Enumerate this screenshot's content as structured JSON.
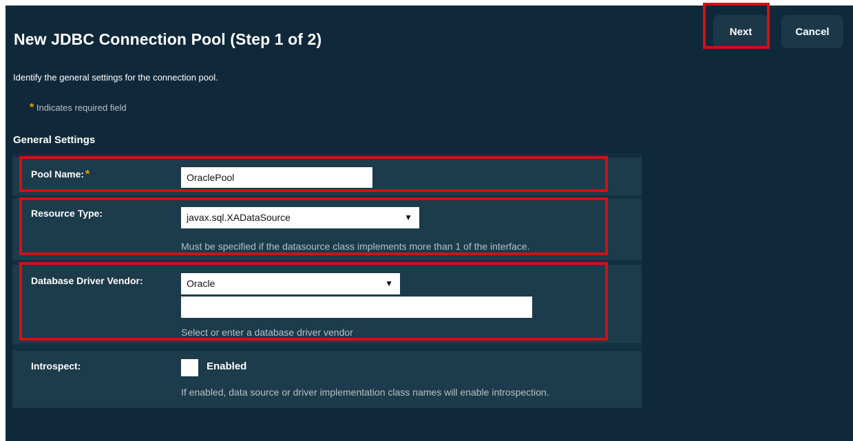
{
  "header": {
    "title": "New JDBC Connection Pool (Step 1 of 2)",
    "next_label": "Next",
    "cancel_label": "Cancel"
  },
  "intro_text": "Identify the general settings for the connection pool.",
  "required_note": {
    "star": "*",
    "text": "Indicates required field"
  },
  "section_title": "General Settings",
  "form": {
    "pool_name": {
      "label": "Pool Name:",
      "required_star": "*",
      "value": "OraclePool"
    },
    "resource_type": {
      "label": "Resource Type:",
      "selected": "javax.sql.XADataSource",
      "help": "Must be specified if the datasource class implements more than 1 of the interface."
    },
    "driver_vendor": {
      "label": "Database Driver Vendor:",
      "selected": "Oracle",
      "custom_value": "",
      "help": "Select or enter a database driver vendor"
    },
    "introspect": {
      "label": "Introspect:",
      "checkbox_label": "Enabled",
      "checked": false,
      "help": "If enabled, data source or driver implementation class names will enable introspection."
    }
  },
  "icons": {
    "dropdown": "▼"
  },
  "colors": {
    "background": "#10293a",
    "row": "#1c3b4b",
    "accent_required": "#f5a300",
    "highlight": "#d60f10",
    "button": "#1c3848"
  }
}
